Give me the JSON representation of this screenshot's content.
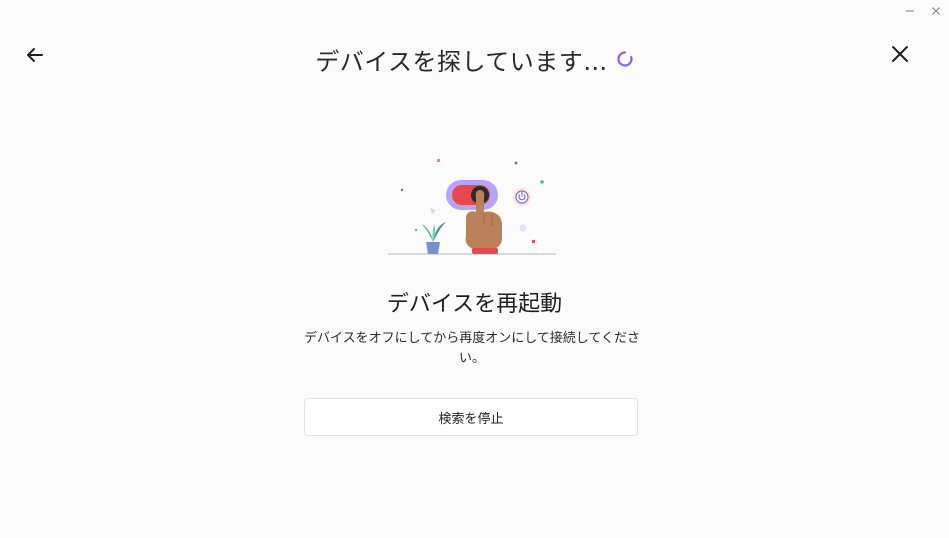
{
  "window_controls": {
    "minimize_icon": "minimize-icon",
    "close_icon": "window-close-icon"
  },
  "header": {
    "title": "デバイスを探しています…",
    "back_icon": "arrow-left-icon",
    "close_icon": "close-icon",
    "spinner_icon": "loading-spinner-icon"
  },
  "main": {
    "section_title": "デバイスを再起動",
    "description": "デバイスをオフにしてから再度オンにして接続してください。",
    "stop_button_label": "検索を停止"
  },
  "colors": {
    "accent": "#8b5cf6",
    "background": "#fbfbfb",
    "toggle_red": "#e5484d",
    "hand_brown": "#b9805a",
    "plant_green": "#56b89a"
  }
}
